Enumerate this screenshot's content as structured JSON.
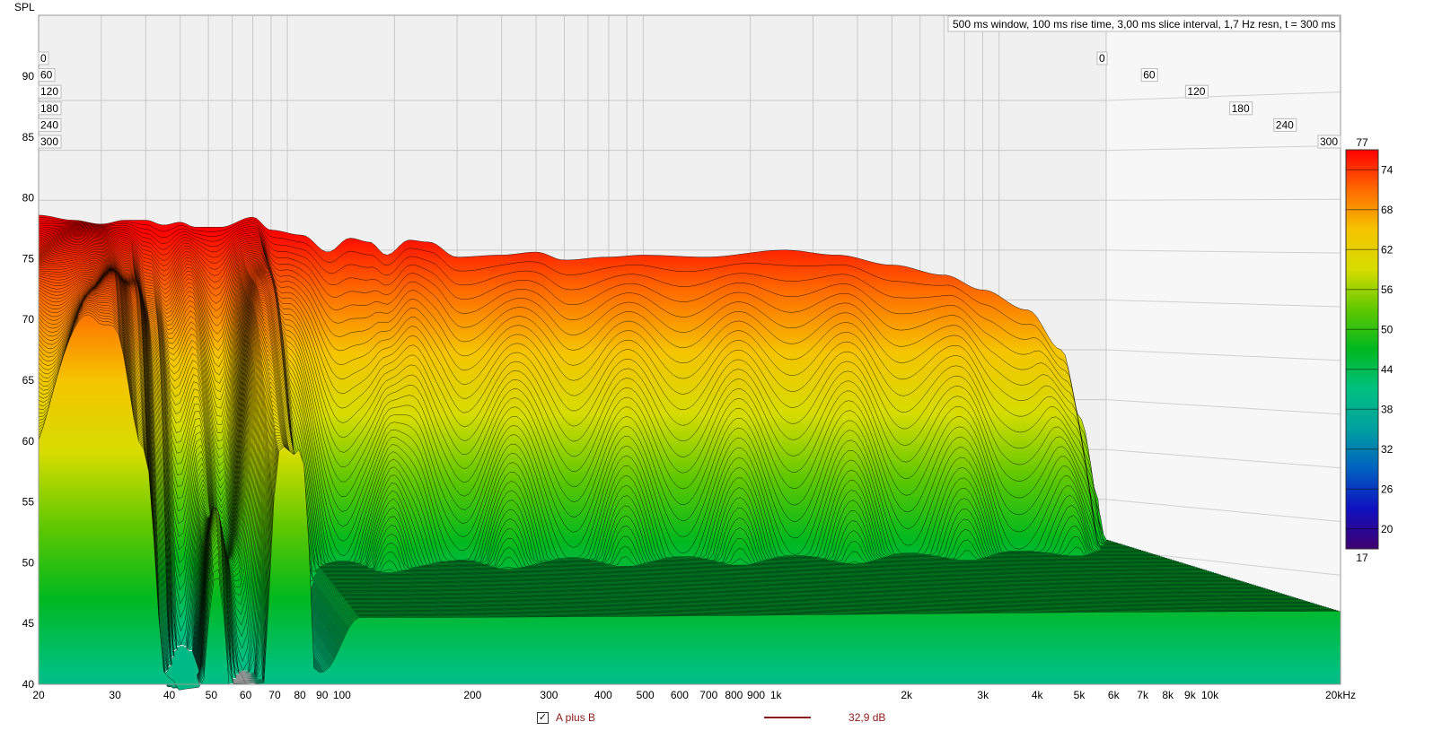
{
  "chart_data": {
    "type": "waterfall",
    "title": "500 ms window, 100 ms rise time, 3,00 ms slice interval, 1,7 Hz resn, t = 300 ms",
    "ylabel": "SPL",
    "xlabel": "",
    "x_unit_suffix": "Hz",
    "xlim": [
      20,
      20000
    ],
    "ylim": [
      40,
      93
    ],
    "y_ticks": [
      40,
      45,
      50,
      55,
      60,
      65,
      70,
      75,
      80,
      85,
      90
    ],
    "x_ticks": [
      {
        "v": 20,
        "label": "20"
      },
      {
        "v": 30,
        "label": "30"
      },
      {
        "v": 40,
        "label": "40"
      },
      {
        "v": 50,
        "label": "50"
      },
      {
        "v": 60,
        "label": "60"
      },
      {
        "v": 70,
        "label": "70"
      },
      {
        "v": 80,
        "label": "80"
      },
      {
        "v": 90,
        "label": "90"
      },
      {
        "v": 100,
        "label": "100"
      },
      {
        "v": 200,
        "label": "200"
      },
      {
        "v": 300,
        "label": "300"
      },
      {
        "v": 400,
        "label": "400"
      },
      {
        "v": 500,
        "label": "500"
      },
      {
        "v": 600,
        "label": "600"
      },
      {
        "v": 700,
        "label": "700"
      },
      {
        "v": 800,
        "label": "800"
      },
      {
        "v": 900,
        "label": "900"
      },
      {
        "v": 1000,
        "label": "1k"
      },
      {
        "v": 2000,
        "label": "2k"
      },
      {
        "v": 3000,
        "label": "3k"
      },
      {
        "v": 4000,
        "label": "4k"
      },
      {
        "v": 5000,
        "label": "5k"
      },
      {
        "v": 6000,
        "label": "6k"
      },
      {
        "v": 7000,
        "label": "7k"
      },
      {
        "v": 8000,
        "label": "8k"
      },
      {
        "v": 9000,
        "label": "9k"
      },
      {
        "v": 10000,
        "label": "10k"
      },
      {
        "v": 20000,
        "label": "20kHz"
      }
    ],
    "time_ticks": [
      "0",
      "60",
      "120",
      "180",
      "240",
      "300"
    ],
    "time_range_ms": [
      0,
      300
    ],
    "slice_interval_ms": 3,
    "colorbar": {
      "range": [
        17,
        77
      ],
      "ticks": [
        "77",
        "74",
        "68",
        "62",
        "56",
        "50",
        "44",
        "38",
        "32",
        "26",
        "20",
        "17"
      ],
      "stops": [
        {
          "db": 77,
          "color": "#ff0000"
        },
        {
          "db": 71,
          "color": "#ff6a00"
        },
        {
          "db": 65,
          "color": "#f5c400"
        },
        {
          "db": 59,
          "color": "#d6dc00"
        },
        {
          "db": 53,
          "color": "#60c800"
        },
        {
          "db": 47,
          "color": "#00b820"
        },
        {
          "db": 41,
          "color": "#00c080"
        },
        {
          "db": 35,
          "color": "#00a0a0"
        },
        {
          "db": 29,
          "color": "#0060c0"
        },
        {
          "db": 23,
          "color": "#1010c0"
        },
        {
          "db": 17,
          "color": "#400070"
        }
      ]
    },
    "initial_slice": [
      [
        20,
        78.5
      ],
      [
        25,
        78
      ],
      [
        30,
        77.6
      ],
      [
        35,
        78
      ],
      [
        40,
        78
      ],
      [
        45,
        77.5
      ],
      [
        50,
        77.8
      ],
      [
        55,
        77.3
      ],
      [
        65,
        77.3
      ],
      [
        80,
        78.3
      ],
      [
        90,
        77
      ],
      [
        110,
        76.5
      ],
      [
        130,
        74.8
      ],
      [
        150,
        76.2
      ],
      [
        170,
        75.8
      ],
      [
        190,
        74.5
      ],
      [
        220,
        76
      ],
      [
        250,
        75.8
      ],
      [
        300,
        74.3
      ],
      [
        400,
        74.5
      ],
      [
        500,
        74.8
      ],
      [
        600,
        74
      ],
      [
        800,
        74.3
      ],
      [
        1000,
        74.5
      ],
      [
        1500,
        74.3
      ],
      [
        2500,
        75
      ],
      [
        3500,
        74.5
      ],
      [
        5000,
        73.5
      ],
      [
        7000,
        72.5
      ],
      [
        9000,
        71
      ],
      [
        12000,
        69
      ],
      [
        15000,
        65
      ],
      [
        17000,
        58
      ],
      [
        19000,
        50
      ],
      [
        20000,
        46
      ]
    ],
    "decay_db_per_ms": [
      [
        20,
        0.06
      ],
      [
        27,
        0.03
      ],
      [
        30,
        0.025
      ],
      [
        35,
        0.05
      ],
      [
        40,
        0.12
      ],
      [
        45,
        0.2
      ],
      [
        52,
        0.12
      ],
      [
        60,
        0.18
      ],
      [
        72,
        0.05
      ],
      [
        80,
        0.06
      ],
      [
        95,
        0.25
      ],
      [
        120,
        0.35
      ],
      [
        1000,
        0.4
      ],
      [
        20000,
        0.45
      ]
    ],
    "noise_floor": [
      [
        20,
        38
      ],
      [
        60,
        40
      ],
      [
        90,
        41
      ],
      [
        110,
        45.5
      ],
      [
        20000,
        46
      ]
    ],
    "series": [
      {
        "name": "A plus B",
        "value_label": "32,9 dB",
        "color": "#8b1a1a",
        "checked": true
      }
    ]
  }
}
